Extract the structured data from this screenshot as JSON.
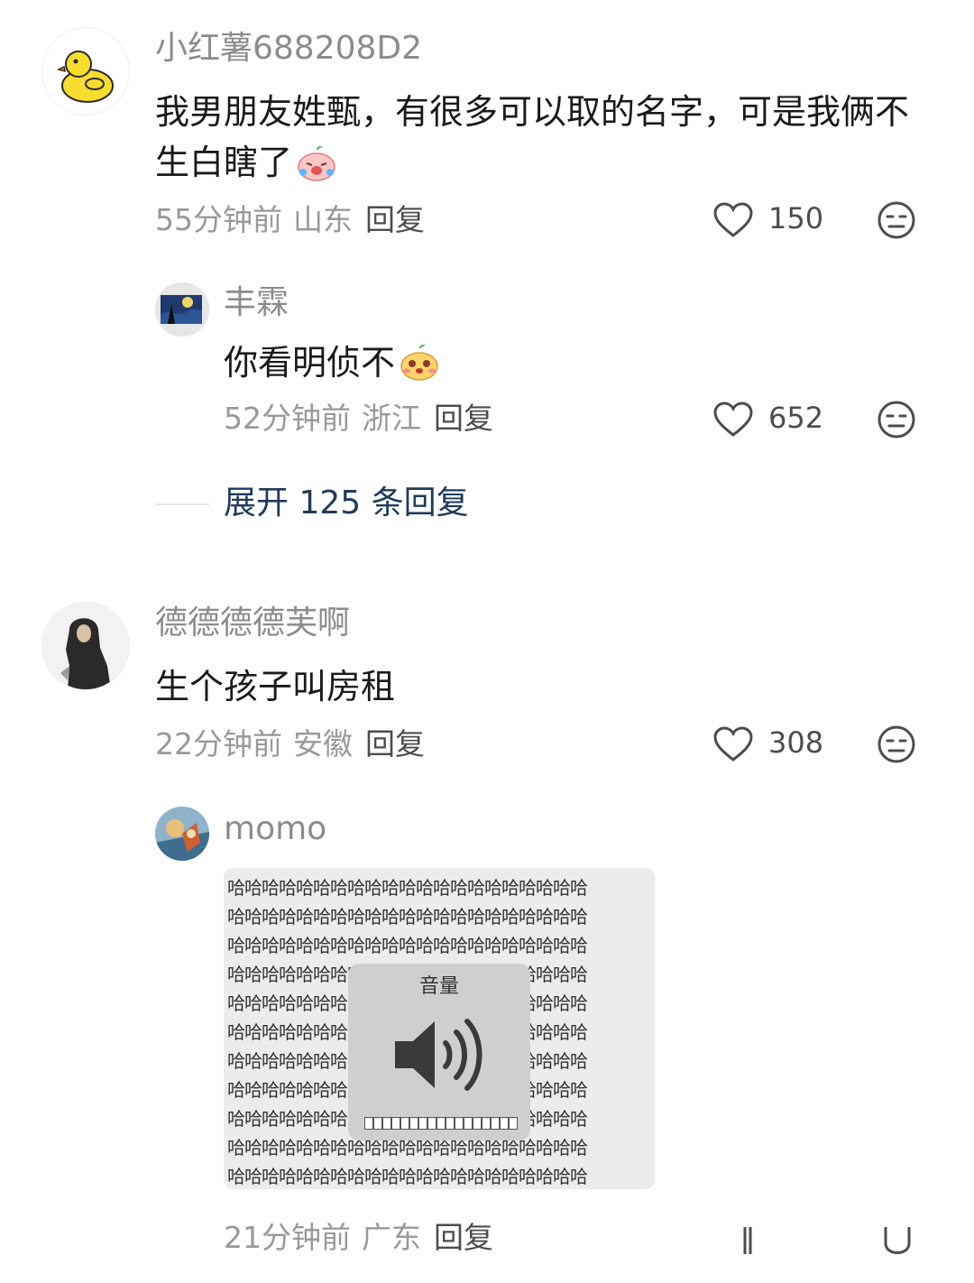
{
  "comments": [
    {
      "username": "小红薯688208D2",
      "text": "我男朋友姓甄，有很多可以取的名字，可是我俩不生白瞎了",
      "time": "55分钟前",
      "region": "山东",
      "reply_label": "回复",
      "likes": "150",
      "emoji_icon": "crying-peach-emoji",
      "replies": [
        {
          "username": "丰霖",
          "text": "你看明侦不",
          "time": "52分钟前",
          "region": "浙江",
          "reply_label": "回复",
          "likes": "652",
          "emoji_icon": "blushing-peach-emoji"
        }
      ],
      "expand_label": "展开 125 条回复"
    },
    {
      "username": "德德德德芙啊",
      "text": "生个孩子叫房租",
      "time": "22分钟前",
      "region": "安徽",
      "reply_label": "回复",
      "likes": "308",
      "replies": [
        {
          "username": "momo",
          "image": {
            "char": "哈",
            "overlay_title": "音量",
            "volume_icon": "speaker-volume-icon",
            "volume_level": 1.0
          },
          "time": "21分钟前",
          "region": "广东",
          "reply_label": "回复"
        }
      ]
    }
  ],
  "colors": {
    "username": "#8c8c8c",
    "meta": "#999999",
    "expand": "#1f3a5c"
  }
}
